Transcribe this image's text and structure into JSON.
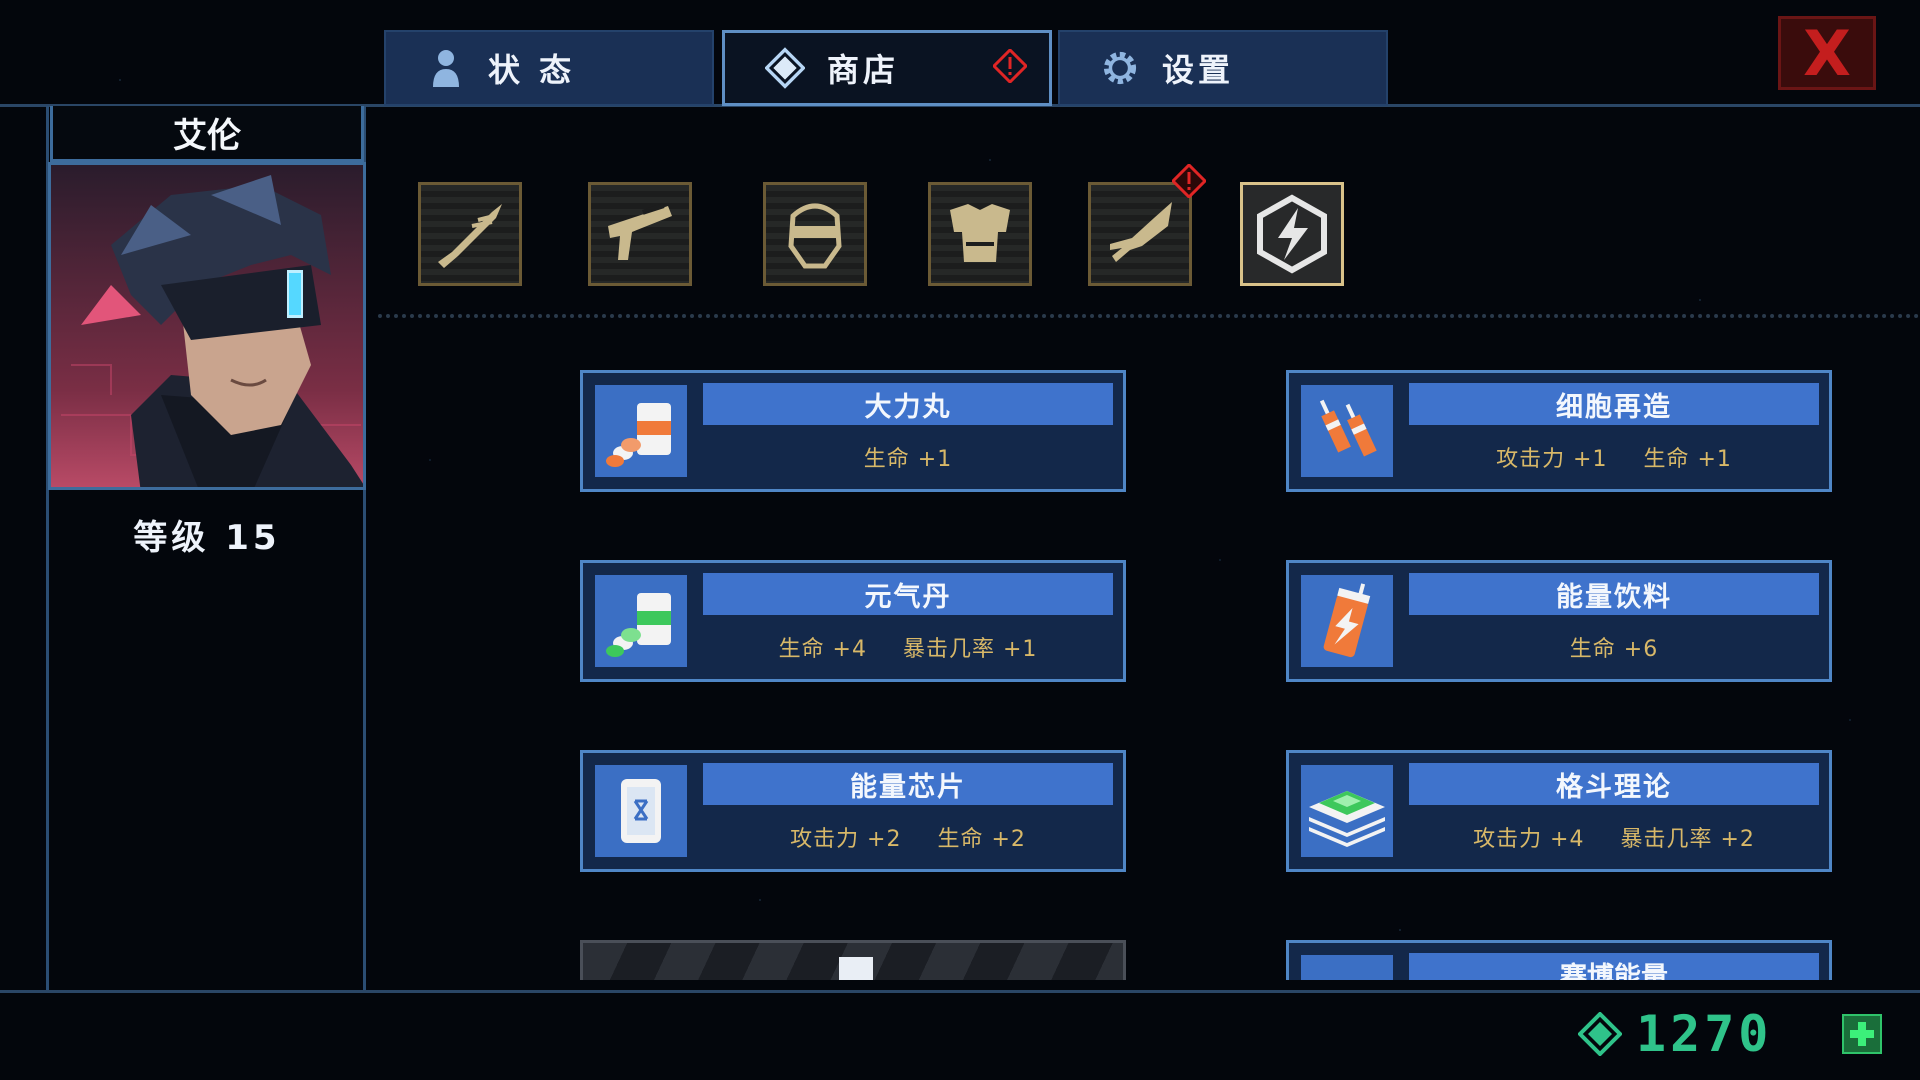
{
  "tabs": [
    {
      "label": "状 态",
      "icon": "person-icon"
    },
    {
      "label": "商店",
      "icon": "diamond-icon",
      "alert": true
    },
    {
      "label": "设置",
      "icon": "gear-icon"
    }
  ],
  "close_label": "X",
  "character": {
    "name": "艾伦",
    "level_text": "等级 15"
  },
  "categories": [
    {
      "icon": "blade-weapon-icon"
    },
    {
      "icon": "gun-icon"
    },
    {
      "icon": "helmet-icon"
    },
    {
      "icon": "armor-icon"
    },
    {
      "icon": "mech-arm-icon",
      "alert": true
    },
    {
      "icon": "lightning-icon",
      "active": true
    }
  ],
  "items": [
    {
      "name": "大力丸",
      "stats": [
        "生命 +1"
      ],
      "icon": "pill-jar-icon"
    },
    {
      "name": "细胞再造",
      "stats": [
        "攻击力 +1",
        "生命 +1"
      ],
      "icon": "syringe-icon"
    },
    {
      "name": "元气丹",
      "stats": [
        "生命 +4",
        "暴击几率 +1"
      ],
      "icon": "green-pill-jar-icon"
    },
    {
      "name": "能量饮料",
      "stats": [
        "生命 +6"
      ],
      "icon": "energy-drink-icon"
    },
    {
      "name": "能量芯片",
      "stats": [
        "攻击力 +2",
        "生命 +2"
      ],
      "icon": "chip-icon"
    },
    {
      "name": "格斗理论",
      "stats": [
        "攻击力 +4",
        "暴击几率 +2"
      ],
      "icon": "book-stack-icon"
    }
  ],
  "partial_item": {
    "name": "赛博能量"
  },
  "currency": {
    "value": "1270"
  },
  "colors": {
    "accent": "#4f86c6",
    "stat_text": "#d8b868",
    "currency": "#2fc38a",
    "close": "#c41e1e"
  }
}
